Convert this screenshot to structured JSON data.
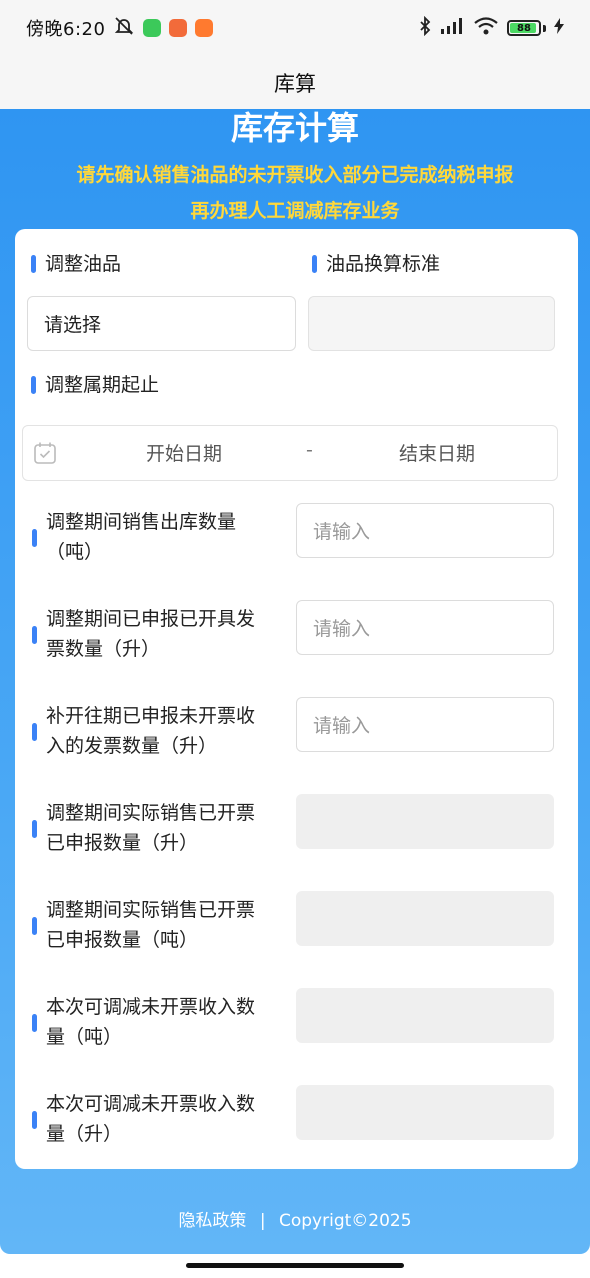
{
  "status_bar": {
    "time": "傍晚6:20",
    "battery": "88"
  },
  "nav": {
    "title": "库算"
  },
  "hero": {
    "title": "库存计算",
    "notice_line1": "请先确认销售油品的未开票收入部分已完成纳税申报",
    "notice_line2": "再办理人工调减库存业务"
  },
  "form": {
    "oil_label": "调整油品",
    "oil_select_value": "请选择",
    "conversion_label": "油品换算标准",
    "period_label": "调整属期起止",
    "date_start": "开始日期",
    "date_separator": "-",
    "date_end": "结束日期",
    "rows": [
      {
        "label_l1": "调整期间销售出库数量",
        "label_l2": "（吨）",
        "placeholder": "请输入"
      },
      {
        "label_l1": "调整期间已申报已开具发",
        "label_l2": "票数量（升）",
        "placeholder": "请输入"
      },
      {
        "label_l1": "补开往期已申报未开票收",
        "label_l2": "入的发票数量（升）",
        "placeholder": "请输入"
      },
      {
        "label_l1": "调整期间实际销售已开票",
        "label_l2": "已申报数量（升）"
      },
      {
        "label_l1": "调整期间实际销售已开票",
        "label_l2": "已申报数量（吨）"
      },
      {
        "label_l1": "本次可调减未开票收入数",
        "label_l2": "量（吨）"
      },
      {
        "label_l1": "本次可调减未开票收入数",
        "label_l2": "量（升）"
      }
    ]
  },
  "footer": {
    "privacy": "隐私政策",
    "separator": "|",
    "copyright": "Copyrigt©2025"
  }
}
